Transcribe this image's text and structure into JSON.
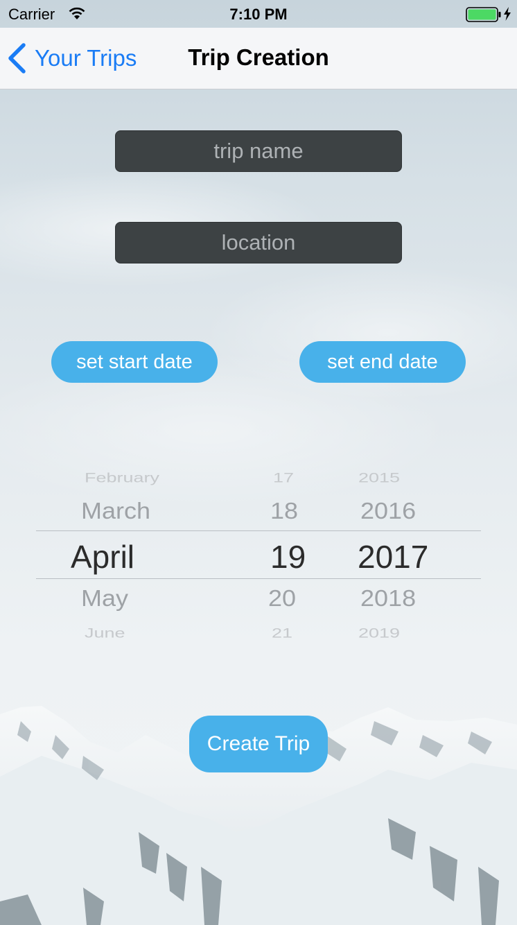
{
  "status_bar": {
    "carrier": "Carrier",
    "time": "7:10 PM",
    "wifi_icon": "wifi-icon",
    "battery_icon": "battery-charging-icon",
    "battery_color": "#4cd964"
  },
  "nav": {
    "back_label": "Your Trips",
    "back_icon": "chevron-left-icon",
    "title": "Trip Creation",
    "tint_color": "#1a7cf5"
  },
  "form": {
    "trip_name": {
      "value": "",
      "placeholder": "trip name"
    },
    "location": {
      "value": "",
      "placeholder": "location"
    }
  },
  "buttons": {
    "start_date": "set start date",
    "end_date": "set end date",
    "create": "Create Trip",
    "color": "#48b1ea"
  },
  "date_picker": {
    "months": [
      "February",
      "March",
      "April",
      "May",
      "June"
    ],
    "days": [
      "17",
      "18",
      "19",
      "20",
      "21"
    ],
    "years": [
      "2015",
      "2016",
      "2017",
      "2018",
      "2019"
    ],
    "selected": {
      "month": "April",
      "day": "19",
      "year": "2017"
    }
  }
}
